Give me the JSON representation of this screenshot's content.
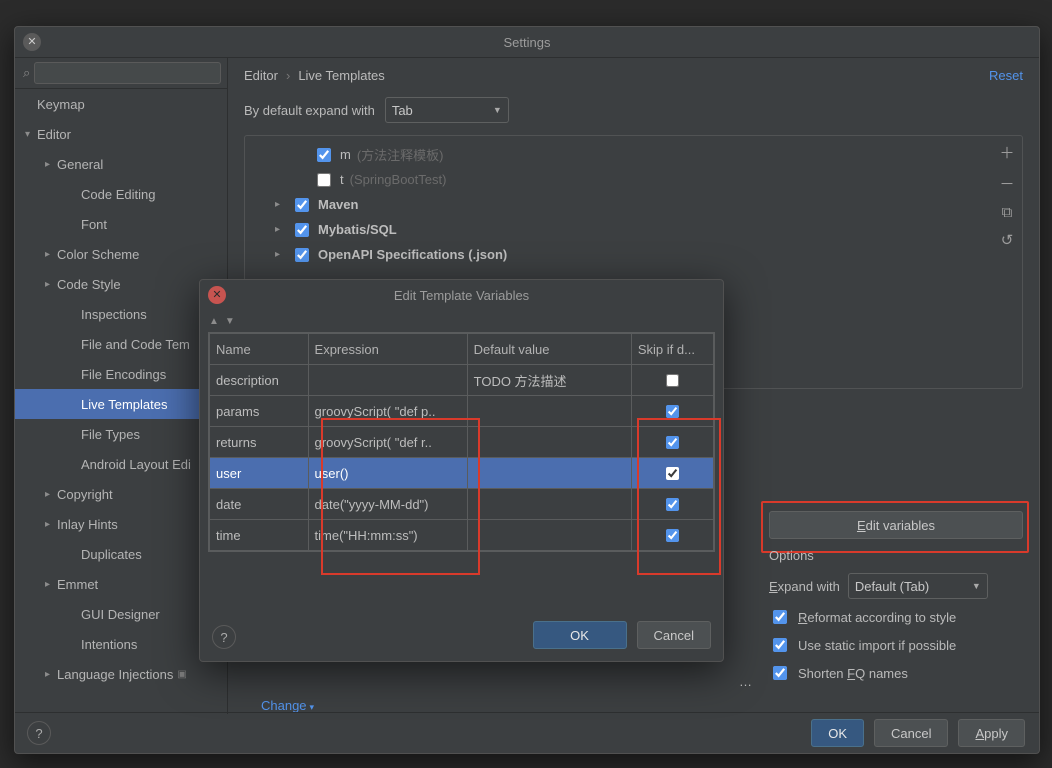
{
  "window": {
    "title": "Settings"
  },
  "breadcrumb": {
    "a": "Editor",
    "b": "Live Templates",
    "sep": "›",
    "reset": "Reset"
  },
  "search": {
    "placeholder": ""
  },
  "expand_with": {
    "label": "By default expand with",
    "value": "Tab"
  },
  "templates": {
    "items": [
      {
        "chev": "",
        "checked": true,
        "label": "m",
        "desc": "(方法注释模板)",
        "indent": 2
      },
      {
        "chev": "",
        "checked": false,
        "label": "t",
        "desc": "(SpringBootTest)",
        "indent": 2
      },
      {
        "chev": "▸",
        "checked": true,
        "label": "Maven",
        "desc": "",
        "indent": 1
      },
      {
        "chev": "▸",
        "checked": true,
        "label": "Mybatis/SQL",
        "desc": "",
        "indent": 1
      },
      {
        "chev": "▸",
        "checked": true,
        "label": "OpenAPI Specifications (.json)",
        "desc": "",
        "indent": 1
      }
    ]
  },
  "sidebar": [
    {
      "label": "Keymap",
      "level": 0
    },
    {
      "label": "Editor",
      "level": 0,
      "chev": "expanded"
    },
    {
      "label": "General",
      "level": 1,
      "chev": "collapsed"
    },
    {
      "label": "Code Editing",
      "level": 2
    },
    {
      "label": "Font",
      "level": 2
    },
    {
      "label": "Color Scheme",
      "level": 1,
      "chev": "collapsed"
    },
    {
      "label": "Code Style",
      "level": 1,
      "chev": "collapsed"
    },
    {
      "label": "Inspections",
      "level": 2
    },
    {
      "label": "File and Code Tem",
      "level": 2
    },
    {
      "label": "File Encodings",
      "level": 2
    },
    {
      "label": "Live Templates",
      "level": 2,
      "selected": true
    },
    {
      "label": "File Types",
      "level": 2
    },
    {
      "label": "Android Layout Edi",
      "level": 2
    },
    {
      "label": "Copyright",
      "level": 1,
      "chev": "collapsed"
    },
    {
      "label": "Inlay Hints",
      "level": 1,
      "chev": "collapsed"
    },
    {
      "label": "Duplicates",
      "level": 2
    },
    {
      "label": "Emmet",
      "level": 1,
      "chev": "collapsed"
    },
    {
      "label": "GUI Designer",
      "level": 2
    },
    {
      "label": "Intentions",
      "level": 2
    },
    {
      "label": "Language Injections",
      "level": 1,
      "chev": "collapsed",
      "badge": "▣"
    }
  ],
  "edit_vars_button": "Edit variables",
  "options": {
    "title": "Options",
    "expand_label": "Expand with",
    "expand_value": "Default (Tab)",
    "reformat": "Reformat according to style",
    "static_import": "Use static import if possible",
    "shorten": "Shorten FQ names"
  },
  "change_link": "Change",
  "footer": {
    "ok": "OK",
    "cancel": "Cancel",
    "apply": "Apply"
  },
  "dialog": {
    "title": "Edit Template Variables",
    "columns": {
      "name": "Name",
      "expr": "Expression",
      "def": "Default value",
      "skip": "Skip if d..."
    },
    "rows": [
      {
        "name": "description",
        "expr": "",
        "def": "TODO 方法描述",
        "skip": false
      },
      {
        "name": "params",
        "expr": "groovyScript( \"def p..",
        "def": "",
        "skip": true
      },
      {
        "name": "returns",
        "expr": "groovyScript( \"def r..",
        "def": "",
        "skip": true
      },
      {
        "name": "user",
        "expr": "user()",
        "def": "",
        "skip": true,
        "selected": true
      },
      {
        "name": "date",
        "expr": "date(\"yyyy-MM-dd\")",
        "def": "",
        "skip": true
      },
      {
        "name": "time",
        "expr": "time(\"HH:mm:ss\")",
        "def": "",
        "skip": true
      }
    ],
    "btn_ok": "OK",
    "btn_cancel": "Cancel"
  }
}
